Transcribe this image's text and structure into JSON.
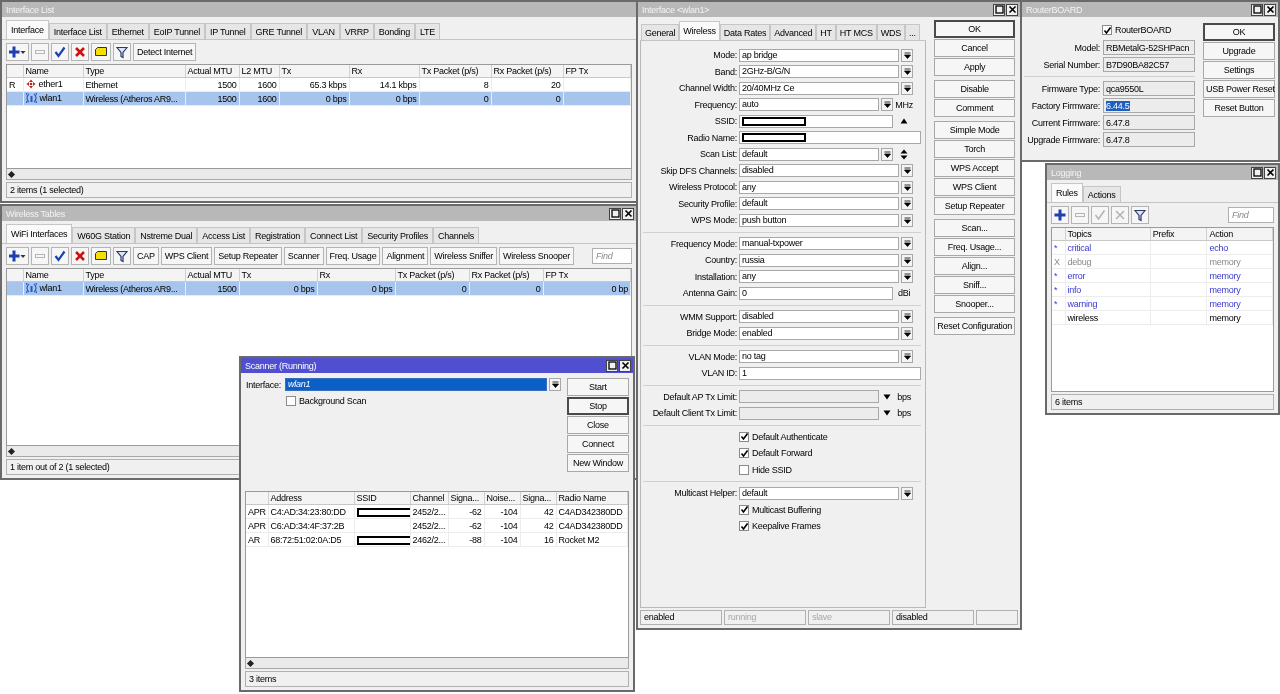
{
  "interface_list": {
    "title": "Interface List",
    "active": false,
    "tabs": [
      {
        "label": "Interface",
        "selected": true
      },
      {
        "label": "Interface List",
        "selected": false
      },
      {
        "label": "Ethernet",
        "selected": false
      },
      {
        "label": "EoIP Tunnel",
        "selected": false
      },
      {
        "label": "IP Tunnel",
        "selected": false
      },
      {
        "label": "GRE Tunnel",
        "selected": false
      },
      {
        "label": "VLAN",
        "selected": false
      },
      {
        "label": "VRRP",
        "selected": false
      },
      {
        "label": "Bonding",
        "selected": false
      },
      {
        "label": "LTE",
        "selected": false
      }
    ],
    "tools": [
      {
        "kind": "add",
        "disabled": false
      },
      {
        "kind": "remove",
        "disabled": true
      },
      {
        "kind": "enable",
        "disabled": false
      },
      {
        "kind": "disable",
        "disabled": false
      },
      {
        "kind": "comment",
        "disabled": false
      },
      {
        "kind": "filter",
        "disabled": false
      }
    ],
    "buttons": [
      "Detect Internet"
    ],
    "columns": [
      "Name",
      "Type",
      "Actual MTU",
      "L2 MTU",
      "Tx",
      "Rx",
      "Tx Packet (p/s)",
      "Rx Packet (p/s)",
      "FP Tx"
    ],
    "rows": [
      {
        "flag": "R",
        "kind": "ethernet",
        "selected": false,
        "cells": [
          "ether1",
          "Ethernet",
          "1500",
          "1600",
          "65.3 kbps",
          "14.1 kbps",
          "8",
          "20"
        ]
      },
      {
        "kind": "wireless",
        "selected": true,
        "cells": [
          "wlan1",
          "Wireless (Atheros AR9...",
          "1500",
          "1600",
          "0 bps",
          "0 bps",
          "0",
          "0"
        ]
      }
    ],
    "status": "2 items (1 selected)"
  },
  "wireless_tables": {
    "title": "Wireless Tables",
    "active": false,
    "tabs": [
      {
        "label": "WiFi Interfaces",
        "selected": true
      },
      {
        "label": "W60G Station",
        "selected": false
      },
      {
        "label": "Nstreme Dual",
        "selected": false
      },
      {
        "label": "Access List",
        "selected": false
      },
      {
        "label": "Registration",
        "selected": false
      },
      {
        "label": "Connect List",
        "selected": false
      },
      {
        "label": "Security Profiles",
        "selected": false
      },
      {
        "label": "Channels",
        "selected": false
      }
    ],
    "tools": [
      {
        "kind": "add",
        "disabled": false
      },
      {
        "kind": "remove",
        "disabled": true
      },
      {
        "kind": "enable",
        "disabled": false
      },
      {
        "kind": "disable",
        "disabled": false
      },
      {
        "kind": "comment",
        "disabled": false
      },
      {
        "kind": "filter",
        "disabled": false
      }
    ],
    "buttons": [
      "CAP",
      "WPS Client",
      "Setup Repeater",
      "Scanner",
      "Freq. Usage",
      "Alignment",
      "Wireless Sniffer",
      "Wireless Snooper"
    ],
    "find": {
      "placeholder": "Find"
    },
    "columns": [
      "Name",
      "Type",
      "Actual MTU",
      "Tx",
      "Rx",
      "Tx Packet (p/s)",
      "Rx Packet (p/s)",
      "FP Tx"
    ],
    "rows": [
      {
        "kind": "wireless",
        "selected": true,
        "cells": [
          "wlan1",
          "Wireless (Atheros AR9...",
          "1500",
          "0 bps",
          "0 bps",
          "0",
          "0",
          "0 bp"
        ]
      }
    ],
    "status": "1 item out of 2 (1 selected)"
  },
  "scanner": {
    "title": "Scanner (Running)",
    "active": true,
    "interface": {
      "label": "Interface:",
      "value": "wlan1",
      "highlighted": true
    },
    "background_scan": {
      "label": "Background Scan",
      "checked": false
    },
    "buttons": [
      {
        "label": "Start",
        "default": false
      },
      {
        "label": "Stop",
        "default": true
      },
      {
        "label": "Close",
        "default": false
      },
      {
        "label": "Connect",
        "default": false
      },
      {
        "label": "New Window",
        "default": false
      }
    ],
    "columns": [
      "Address",
      "SSID",
      "Channel",
      "Signa...",
      "Noise...",
      "Signa...",
      "Radio Name"
    ],
    "rows": [
      {
        "flag": "APR",
        "address": "C4:AD:34:23:80:DD",
        "ssid_redacted": true,
        "channel": "2452/2...",
        "signal": "-62",
        "noise": "-104",
        "snr": "42",
        "radio_name": "C4AD342380DD"
      },
      {
        "flag": "APR",
        "address": "C6:AD:34:4F:37:2B",
        "ssid_redacted": false,
        "channel": "2452/2...",
        "signal": "-62",
        "noise": "-104",
        "snr": "42",
        "radio_name": "C4AD342380DD"
      },
      {
        "flag": "AR",
        "address": "68:72:51:02:0A:D5",
        "ssid_redacted": true,
        "channel": "2462/2...",
        "signal": "-88",
        "noise": "-104",
        "snr": "16",
        "radio_name": "Rocket M2"
      }
    ],
    "status": "3 items"
  },
  "interface_wlan1": {
    "title": "Interface <wlan1>",
    "active": false,
    "tabs": [
      {
        "label": "General",
        "selected": false
      },
      {
        "label": "Wireless",
        "selected": true
      },
      {
        "label": "Data Rates",
        "selected": false
      },
      {
        "label": "Advanced",
        "selected": false
      },
      {
        "label": "HT",
        "selected": false
      },
      {
        "label": "HT MCS",
        "selected": false
      },
      {
        "label": "WDS",
        "selected": false
      },
      {
        "label": "...",
        "selected": false
      }
    ],
    "sections": [
      [
        {
          "kind": "select",
          "label": "Mode:",
          "value": "ap bridge"
        },
        {
          "kind": "select",
          "label": "Band:",
          "value": "2GHz-B/G/N"
        },
        {
          "kind": "select",
          "label": "Channel Width:",
          "value": "20/40MHz Ce"
        },
        {
          "kind": "select",
          "label": "Frequency:",
          "value": "auto",
          "unit": "MHz"
        },
        {
          "kind": "text",
          "label": "SSID:",
          "redacted": true,
          "collapsible": true
        },
        {
          "kind": "text",
          "label": "Radio Name:",
          "redacted": true
        },
        {
          "kind": "select",
          "label": "Scan List:",
          "value": "default",
          "spinner": true
        },
        {
          "kind": "select",
          "label": "Skip DFS Channels:",
          "value": "disabled"
        },
        {
          "kind": "select",
          "label": "Wireless Protocol:",
          "value": "any"
        },
        {
          "kind": "select",
          "label": "Security Profile:",
          "value": "default"
        },
        {
          "kind": "select",
          "label": "WPS Mode:",
          "value": "push button"
        }
      ],
      [
        {
          "kind": "select",
          "label": "Frequency Mode:",
          "value": "manual-txpower"
        },
        {
          "kind": "select",
          "label": "Country:",
          "value": "russia"
        },
        {
          "kind": "select",
          "label": "Installation:",
          "value": "any"
        },
        {
          "kind": "text",
          "label": "Antenna Gain:",
          "value": "0",
          "unit": "dBi"
        }
      ],
      [
        {
          "kind": "select",
          "label": "WMM Support:",
          "value": "disabled"
        },
        {
          "kind": "select",
          "label": "Bridge Mode:",
          "value": "enabled"
        }
      ],
      [
        {
          "kind": "select",
          "label": "VLAN Mode:",
          "value": "no tag"
        },
        {
          "kind": "text",
          "label": "VLAN ID:",
          "value": "1"
        }
      ],
      [
        {
          "kind": "limit",
          "label": "Default AP Tx Limit:",
          "unit": "bps"
        },
        {
          "kind": "limit",
          "label": "Default Client Tx Limit:",
          "unit": "bps"
        }
      ],
      [
        {
          "kind": "checkbox",
          "label": "Default Authenticate",
          "checked": true
        },
        {
          "kind": "checkbox",
          "label": "Default Forward",
          "checked": true
        },
        {
          "kind": "checkbox",
          "label": "Hide SSID",
          "checked": false
        }
      ],
      [
        {
          "kind": "select",
          "label": "Multicast Helper:",
          "value": "default"
        },
        {
          "kind": "checkbox",
          "label": "Multicast Buffering",
          "checked": true
        },
        {
          "kind": "checkbox",
          "label": "Keepalive Frames",
          "checked": true
        }
      ]
    ],
    "button_groups": [
      [
        {
          "label": "OK",
          "default": true
        },
        {
          "label": "Cancel",
          "default": false
        },
        {
          "label": "Apply",
          "default": false
        }
      ],
      [
        {
          "label": "Disable",
          "default": false
        },
        {
          "label": "Comment",
          "default": false
        }
      ],
      [
        {
          "label": "Simple Mode",
          "default": false
        },
        {
          "label": "Torch",
          "default": false
        },
        {
          "label": "WPS Accept",
          "default": false
        },
        {
          "label": "WPS Client",
          "default": false
        },
        {
          "label": "Setup Repeater",
          "default": false
        }
      ],
      [
        {
          "label": "Scan...",
          "default": false
        },
        {
          "label": "Freq. Usage...",
          "default": false
        },
        {
          "label": "Align...",
          "default": false
        },
        {
          "label": "Sniff...",
          "default": false
        },
        {
          "label": "Snooper...",
          "default": false
        }
      ],
      [
        {
          "label": "Reset Configuration",
          "default": false
        }
      ]
    ],
    "status": [
      {
        "text": "enabled",
        "dim": false
      },
      {
        "text": "running",
        "dim": true
      },
      {
        "text": "slave",
        "dim": true
      },
      {
        "text": "disabled",
        "dim": false
      }
    ]
  },
  "routerboard": {
    "title": "RouterBOARD",
    "active": false,
    "checkbox": {
      "label": "RouterBOARD",
      "checked": true
    },
    "sections": [
      [
        {
          "label": "Model:",
          "value": "RBMetalG-52SHPacn",
          "highlighted": false
        },
        {
          "label": "Serial Number:",
          "value": "B7D90BA82C57",
          "highlighted": false
        }
      ],
      [
        {
          "label": "Firmware Type:",
          "value": "qca9550L",
          "highlighted": false
        },
        {
          "label": "Factory Firmware:",
          "value": "6.44.5",
          "highlighted": true
        },
        {
          "label": "Current Firmware:",
          "value": "6.47.8",
          "highlighted": false
        },
        {
          "label": "Upgrade Firmware:",
          "value": "6.47.8",
          "highlighted": false
        }
      ]
    ],
    "buttons": [
      {
        "label": "OK",
        "default": true
      },
      {
        "label": "Upgrade",
        "default": false
      },
      {
        "label": "Settings",
        "default": false
      },
      {
        "label": "USB Power Reset",
        "default": false
      },
      {
        "label": "Reset Button",
        "default": false
      }
    ]
  },
  "logging": {
    "title": "Logging",
    "active": false,
    "tabs": [
      {
        "label": "Rules",
        "selected": true
      },
      {
        "label": "Actions",
        "selected": false
      }
    ],
    "tools": [
      {
        "kind": "add",
        "disabled": false
      },
      {
        "kind": "remove",
        "disabled": true
      },
      {
        "kind": "enable",
        "disabled": true
      },
      {
        "kind": "disable",
        "disabled": true
      },
      {
        "kind": "filter",
        "disabled": false
      }
    ],
    "find": {
      "placeholder": "Find"
    },
    "columns": [
      "Topics",
      "Prefix",
      "Action"
    ],
    "rows": [
      {
        "flag": "*",
        "kind": "default",
        "topics": "critical",
        "action": "echo"
      },
      {
        "flag": "X",
        "kind": "disabled",
        "topics": "debug",
        "action": "memory"
      },
      {
        "flag": "*",
        "kind": "default",
        "topics": "error",
        "action": "memory"
      },
      {
        "flag": "*",
        "kind": "default",
        "topics": "info",
        "action": "memory"
      },
      {
        "flag": "*",
        "kind": "default",
        "topics": "warning",
        "action": "memory"
      },
      {
        "kind": "normal",
        "topics": "wireless",
        "action": "memory"
      }
    ],
    "status": "6 items"
  }
}
